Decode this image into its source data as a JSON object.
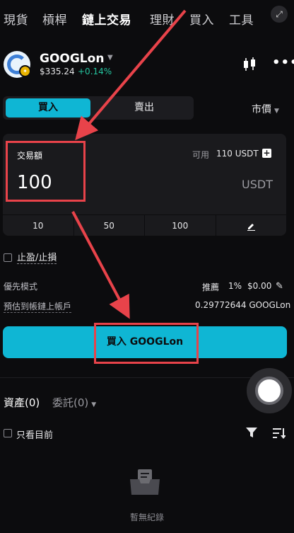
{
  "nav": {
    "tabs": [
      "現貨",
      "槓桿",
      "鏈上交易",
      "理財",
      "買入",
      "工具"
    ],
    "active_index": 2
  },
  "coin": {
    "name": "GOOGLon",
    "price": "$335.24",
    "change": "+0.14%",
    "change_color": "#25c6a0"
  },
  "side_toggle": {
    "buy_label": "買入",
    "sell_label": "賣出"
  },
  "order_type": {
    "label": "市價"
  },
  "amount": {
    "label": "交易額",
    "available_label": "可用",
    "available_value": "110 USDT",
    "value": "100",
    "unit": "USDT",
    "quick_amounts": [
      "10",
      "50",
      "100"
    ]
  },
  "tpsl": {
    "label": "止盈/止損"
  },
  "preference": {
    "label": "優先模式",
    "mode": "推薦",
    "percent": "1%",
    "fee": "$0.00"
  },
  "estimate": {
    "label": "預估到帳鏈上帳戶",
    "value": "0.29772644 GOOGLon"
  },
  "buy_button": {
    "label": "買入 GOOGLon"
  },
  "bottom_tabs": {
    "assets": "資產(0)",
    "orders": "委託(0)"
  },
  "filter": {
    "label": "只看目前"
  },
  "empty": {
    "label": "暫無紀錄"
  },
  "colors": {
    "accent": "#0fb6d4",
    "highlight": "#e8434a",
    "background": "#0c0c0e"
  }
}
